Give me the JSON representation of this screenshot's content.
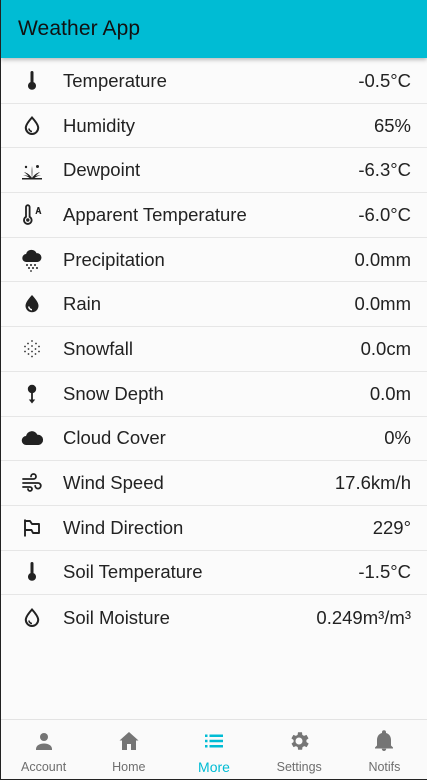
{
  "app": {
    "title": "Weather App"
  },
  "metrics": [
    {
      "icon": "thermometer-icon",
      "label": "Temperature",
      "value": "-0.5°C"
    },
    {
      "icon": "water-drop-outline-icon",
      "label": "Humidity",
      "value": "65%"
    },
    {
      "icon": "grass-dew-icon",
      "label": "Dewpoint",
      "value": "-6.3°C"
    },
    {
      "icon": "thermometer-apparent-icon",
      "label": "Apparent Temperature",
      "value": "-6.0°C"
    },
    {
      "icon": "cloud-snow-icon",
      "label": "Precipitation",
      "value": "0.0mm"
    },
    {
      "icon": "rain-drop-icon",
      "label": "Rain",
      "value": "0.0mm"
    },
    {
      "icon": "snowfall-dots-icon",
      "label": "Snowfall",
      "value": "0.0cm"
    },
    {
      "icon": "snow-depth-icon",
      "label": "Snow Depth",
      "value": "0.0m"
    },
    {
      "icon": "cloud-icon",
      "label": "Cloud Cover",
      "value": "0%"
    },
    {
      "icon": "wind-icon",
      "label": "Wind Speed",
      "value": "17.6km/h"
    },
    {
      "icon": "wind-direction-flag-icon",
      "label": "Wind Direction",
      "value": "229°"
    },
    {
      "icon": "thermometer-icon",
      "label": "Soil Temperature",
      "value": "-1.5°C"
    },
    {
      "icon": "water-drop-outline-icon",
      "label": "Soil Moisture",
      "value": "0.249m³/m³"
    }
  ],
  "nav": {
    "items": [
      {
        "icon": "account-icon",
        "label": "Account",
        "active": false
      },
      {
        "icon": "home-icon",
        "label": "Home",
        "active": false
      },
      {
        "icon": "list-icon",
        "label": "More",
        "active": true
      },
      {
        "icon": "gear-icon",
        "label": "Settings",
        "active": false
      },
      {
        "icon": "bell-icon",
        "label": "Notifs",
        "active": false
      }
    ]
  },
  "colors": {
    "accent": "#00bcd4",
    "inactive": "#757575",
    "text": "#222222"
  }
}
